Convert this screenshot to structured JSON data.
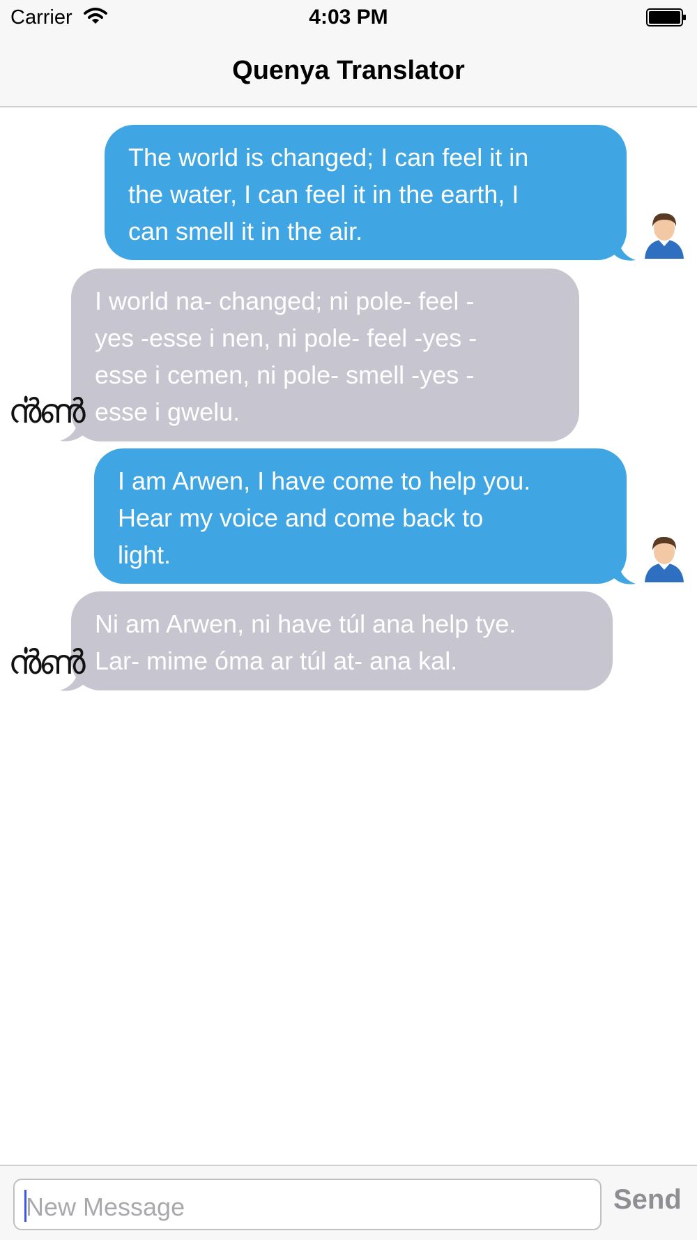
{
  "status_bar": {
    "carrier": "Carrier",
    "time": "4:03 PM"
  },
  "nav": {
    "title": "Quenya Translator"
  },
  "messages": [
    {
      "direction": "outgoing",
      "text": "The world is changed; I can feel it in\nthe water, I can feel it in the earth, I\ncan smell it in the air."
    },
    {
      "direction": "incoming",
      "text": "I world na- changed; ni pole- feel -\nyes -esse i nen,  ni pole- feel -yes -\nesse i cemen,  ni pole- smell -yes -\nesse i gwelu."
    },
    {
      "direction": "outgoing",
      "text": "I am Arwen, I have come to help you.\nHear my voice and come back to\nlight."
    },
    {
      "direction": "incoming",
      "text": "Ni am Arwen,  ni have túl ana help tye.\nLar- mime óma ar túl at- ana kal."
    }
  ],
  "composer": {
    "placeholder": "New Message",
    "send_label": "Send"
  },
  "colors": {
    "outgoing_bubble": "#3fa5e3",
    "incoming_bubble": "#c6c5d0",
    "bar_background": "#f7f7f7"
  },
  "icons": {
    "user_avatar": "user-avatar-icon",
    "bot_avatar": "tengwar-avatar-icon"
  }
}
